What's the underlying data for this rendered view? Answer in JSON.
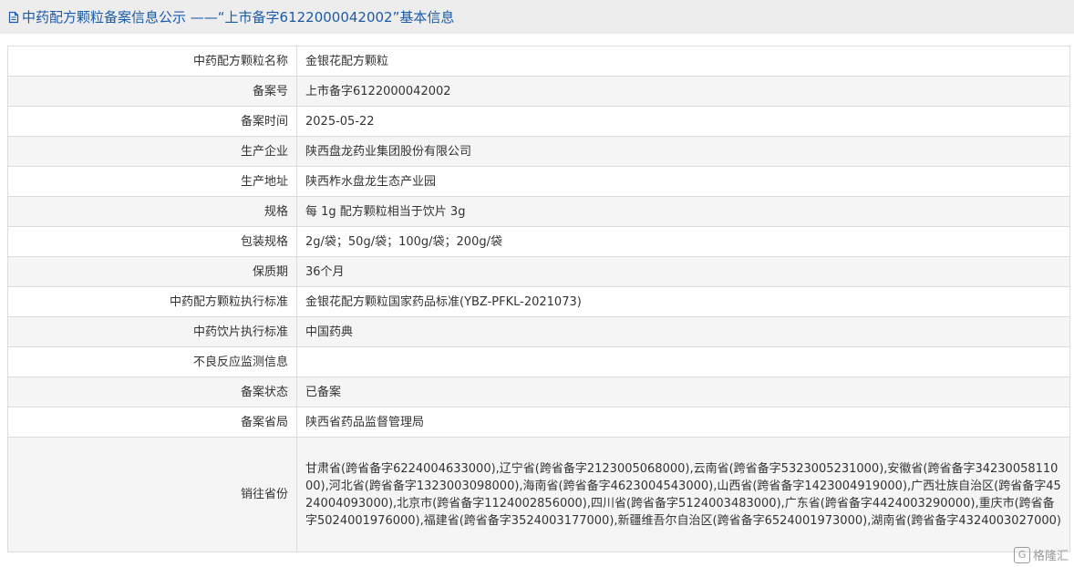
{
  "header": {
    "title": "中药配方颗粒备案信息公示 ——“上市备字6122000042002”基本信息"
  },
  "rows": [
    {
      "label": "中药配方颗粒名称",
      "value": "金银花配方颗粒"
    },
    {
      "label": "备案号",
      "value": "上市备字6122000042002"
    },
    {
      "label": "备案时间",
      "value": "2025-05-22"
    },
    {
      "label": "生产企业",
      "value": "陕西盘龙药业集团股份有限公司"
    },
    {
      "label": "生产地址",
      "value": "陕西柞水盘龙生态产业园"
    },
    {
      "label": "规格",
      "value": "每 1g 配方颗粒相当于饮片 3g"
    },
    {
      "label": "包装规格",
      "value": "2g/袋；50g/袋；100g/袋；200g/袋"
    },
    {
      "label": "保质期",
      "value": "36个月"
    },
    {
      "label": "中药配方颗粒执行标准",
      "value": "金银花配方颗粒国家药品标准(YBZ-PFKL-2021073)"
    },
    {
      "label": "中药饮片执行标准",
      "value": "中国药典"
    },
    {
      "label": "不良反应监测信息",
      "value": ""
    },
    {
      "label": "备案状态",
      "value": "已备案"
    },
    {
      "label": "备案省局",
      "value": "陕西省药品监督管理局"
    },
    {
      "label": "销往省份",
      "value": "甘肃省(跨省备字6224004633000),辽宁省(跨省备字2123005068000),云南省(跨省备字5323005231000),安徽省(跨省备字3423005811000),河北省(跨省备字1323003098000),海南省(跨省备字4623004543000),山西省(跨省备字1423004919000),广西壮族自治区(跨省备字4524004093000),北京市(跨省备字1124002856000),四川省(跨省备字5124003483000),广东省(跨省备字4424003290000),重庆市(跨省备字5024001976000),福建省(跨省备字3524003177000),新疆维吾尔自治区(跨省备字6524001973000),湖南省(跨省备字4324003027000)"
    }
  ],
  "watermark": {
    "text": "格隆汇",
    "logo_char": "G"
  },
  "colors": {
    "accent": "#1d5aa8",
    "header_bg": "#ededed",
    "row_alt": "#f5f5f5",
    "border": "#dcdcdc"
  }
}
